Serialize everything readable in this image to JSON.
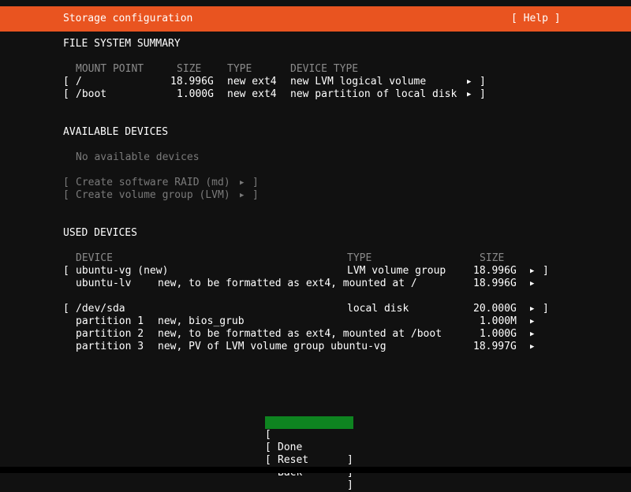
{
  "header": {
    "title": "Storage configuration",
    "help_label": "[ Help ]",
    "color": "#e95420"
  },
  "fs_summary": {
    "heading": "FILE SYSTEM SUMMARY",
    "columns": [
      "MOUNT POINT",
      "SIZE",
      "TYPE",
      "DEVICE TYPE"
    ],
    "rows": [
      {
        "mount": "/",
        "size": "18.996G",
        "type": "new ext4",
        "device_type": "new LVM logical volume"
      },
      {
        "mount": "/boot",
        "size": "1.000G",
        "type": "new ext4",
        "device_type": "new partition of local disk"
      }
    ]
  },
  "available": {
    "heading": "AVAILABLE DEVICES",
    "empty_text": "No available devices",
    "actions": [
      {
        "label": "Create software RAID (md)"
      },
      {
        "label": "Create volume group (LVM)"
      }
    ]
  },
  "used": {
    "heading": "USED DEVICES",
    "columns": [
      "DEVICE",
      "TYPE",
      "SIZE"
    ],
    "devices": [
      {
        "name": "ubuntu-vg (new)",
        "type": "LVM volume group",
        "size": "18.996G",
        "children": [
          {
            "name": "ubuntu-lv",
            "desc": "new, to be formatted as ext4, mounted at /",
            "size": "18.996G"
          }
        ]
      },
      {
        "name": "/dev/sda",
        "type": "local disk",
        "size": "20.000G",
        "children": [
          {
            "name": "partition 1",
            "desc": "new, bios_grub",
            "size": "1.000M"
          },
          {
            "name": "partition 2",
            "desc": "new, to be formatted as ext4, mounted at /boot",
            "size": "1.000G"
          },
          {
            "name": "partition 3",
            "desc": "new, PV of LVM volume group ubuntu-vg",
            "size": "18.997G"
          }
        ]
      }
    ]
  },
  "buttons": {
    "done": "Done",
    "reset": "Reset",
    "back": "Back",
    "focus_color": "#0e8420"
  },
  "glyphs": {
    "open": "[",
    "close": "]",
    "arrow": "▶"
  }
}
